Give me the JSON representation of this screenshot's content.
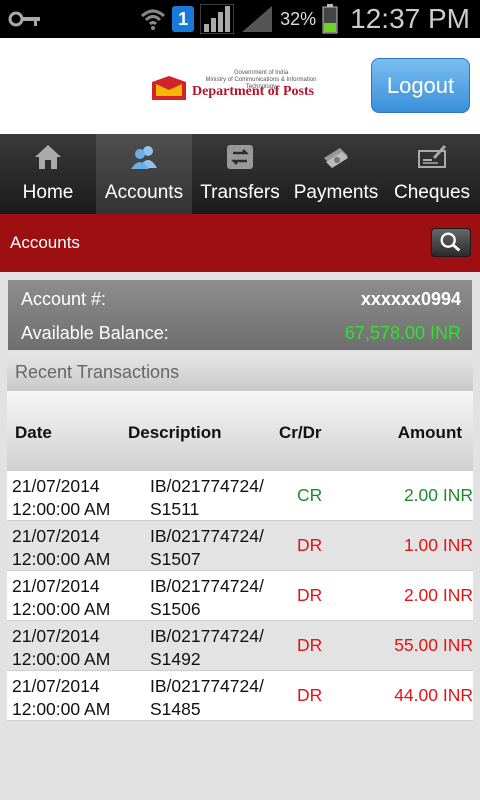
{
  "status_bar": {
    "sim_label": "1",
    "battery_text": "32%",
    "time": "12:37 PM",
    "icons": [
      "key-icon",
      "wifi-icon",
      "sim-icon",
      "signal-icon",
      "battery-icon"
    ]
  },
  "header": {
    "logo_small_lines": [
      "Government of India",
      "Ministry of Communications & Information Technology"
    ],
    "logo_name": "Department of Posts",
    "logout_label": "Logout"
  },
  "nav": {
    "tabs": [
      {
        "label": "Home",
        "icon": "home-icon"
      },
      {
        "label": "Accounts",
        "icon": "users-icon"
      },
      {
        "label": "Transfers",
        "icon": "transfer-icon"
      },
      {
        "label": "Payments",
        "icon": "cash-icon"
      },
      {
        "label": "Cheques",
        "icon": "cheque-icon"
      }
    ],
    "active": "Accounts"
  },
  "section": {
    "title": "Accounts",
    "search_icon": "search-icon"
  },
  "account": {
    "number_label": "Account #:",
    "number_value": "xxxxxx0994",
    "balance_label": "Available Balance:",
    "balance_value": "67,578.00 INR"
  },
  "recent": {
    "title": "Recent Transactions",
    "columns": [
      "Date",
      "Description",
      "Cr/Dr",
      "Amount"
    ],
    "rows": [
      {
        "date_line1": "21/07/2014",
        "date_line2": "12:00:00 AM",
        "desc_line1": "IB/021774724/",
        "desc_line2": "S1511",
        "type": "CR",
        "amount": "2.00 INR"
      },
      {
        "date_line1": "21/07/2014",
        "date_line2": "12:00:00 AM",
        "desc_line1": "IB/021774724/",
        "desc_line2": "S1507",
        "type": "DR",
        "amount": "1.00 INR"
      },
      {
        "date_line1": "21/07/2014",
        "date_line2": "12:00:00 AM",
        "desc_line1": "IB/021774724/",
        "desc_line2": "S1506",
        "type": "DR",
        "amount": "2.00 INR"
      },
      {
        "date_line1": "21/07/2014",
        "date_line2": "12:00:00 AM",
        "desc_line1": "IB/021774724/",
        "desc_line2": "S1492",
        "type": "DR",
        "amount": "55.00 INR"
      },
      {
        "date_line1": "21/07/2014",
        "date_line2": "12:00:00 AM",
        "desc_line1": "IB/021774724/",
        "desc_line2": "S1485",
        "type": "DR",
        "amount": "44.00 INR"
      }
    ]
  },
  "colors": {
    "section_bar": "#9e0f12",
    "credit": "#1f8a2c",
    "debit": "#e21414",
    "balance": "#2ee32e",
    "logout": "#3a8fd9"
  }
}
